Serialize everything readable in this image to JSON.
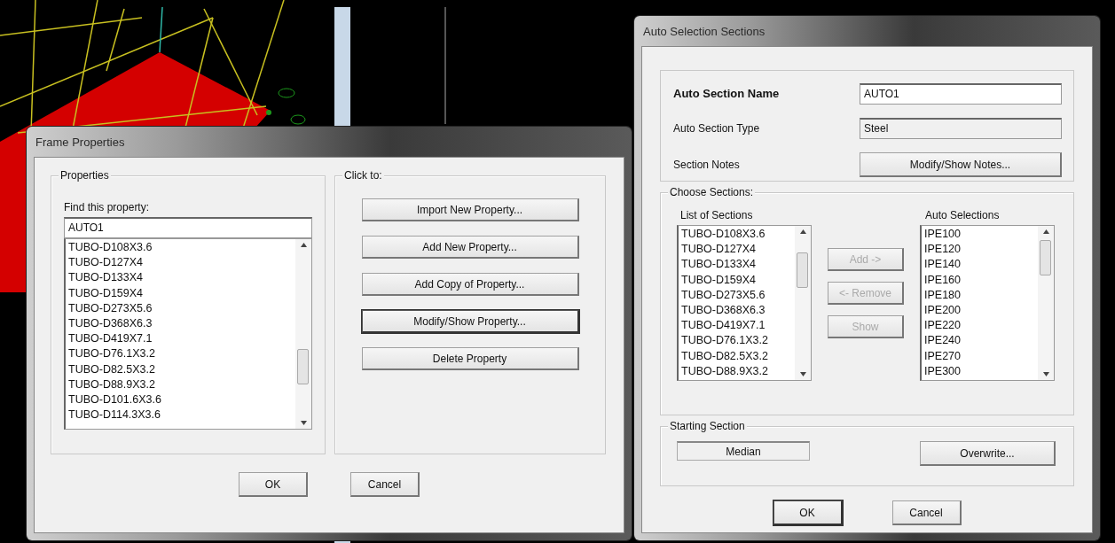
{
  "frame_properties": {
    "title": "Frame Properties",
    "properties_group": {
      "label": "Properties",
      "find_label": "Find this property:",
      "find_value": "AUTO1",
      "items": [
        "TUBO-D108X3.6",
        "TUBO-D127X4",
        "TUBO-D133X4",
        "TUBO-D159X4",
        "TUBO-D273X5.6",
        "TUBO-D368X6.3",
        "TUBO-D419X7.1",
        "TUBO-D76.1X3.2",
        "TUBO-D82.5X3.2",
        "TUBO-D88.9X3.2",
        "TUBO-D101.6X3.6",
        "TUBO-D114.3X3.6"
      ]
    },
    "click_group": {
      "label": "Click to:",
      "buttons": [
        {
          "label": "Import New Property...",
          "focused": false
        },
        {
          "label": "Add New Property...",
          "focused": false
        },
        {
          "label": "Add Copy of Property...",
          "focused": false
        },
        {
          "label": "Modify/Show Property...",
          "focused": true
        },
        {
          "label": "Delete Property",
          "focused": false
        }
      ]
    },
    "buttons": [
      {
        "label": "OK",
        "focused": false
      },
      {
        "label": "Cancel",
        "focused": false
      }
    ]
  },
  "auto_selection": {
    "title": "Auto Selection Sections",
    "name_label": "Auto Section Name",
    "name_value": "AUTO1",
    "type_label": "Auto Section Type",
    "type_value": "Steel",
    "notes_label": "Section Notes",
    "notes_button": "Modify/Show Notes...",
    "choose": {
      "label": "Choose Sections:",
      "list_label": "List of Sections",
      "list_items": [
        "TUBO-D108X3.6",
        "TUBO-D127X4",
        "TUBO-D133X4",
        "TUBO-D159X4",
        "TUBO-D273X5.6",
        "TUBO-D368X6.3",
        "TUBO-D419X7.1",
        "TUBO-D76.1X3.2",
        "TUBO-D82.5X3.2",
        "TUBO-D88.9X3.2"
      ],
      "actions": [
        {
          "label": "Add ->",
          "disabled": true
        },
        {
          "label": "<- Remove",
          "disabled": true
        },
        {
          "label": "Show",
          "disabled": true
        }
      ],
      "auto_label": "Auto Selections",
      "auto_items": [
        "IPE100",
        "IPE120",
        "IPE140",
        "IPE160",
        "IPE180",
        "IPE200",
        "IPE220",
        "IPE240",
        "IPE270",
        "IPE300"
      ]
    },
    "starting": {
      "label": "Starting Section",
      "value": "Median",
      "button": "Overwrite..."
    },
    "buttons": [
      {
        "label": "OK",
        "focused": true
      },
      {
        "label": "Cancel",
        "focused": false
      }
    ]
  }
}
